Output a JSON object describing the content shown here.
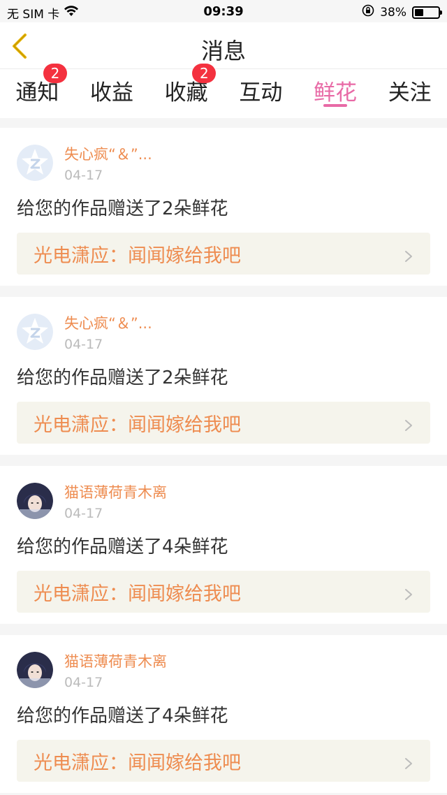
{
  "statusbar": {
    "carrier": "无 SIM 卡",
    "time": "09:39",
    "battery": "38%",
    "battery_level": 0.38
  },
  "navbar": {
    "title": "消息"
  },
  "tabs": [
    {
      "label": "通知",
      "badge": "2"
    },
    {
      "label": "收益",
      "badge": ""
    },
    {
      "label": "收藏",
      "badge": "2"
    },
    {
      "label": "互动",
      "badge": ""
    },
    {
      "label": "鲜花",
      "badge": "",
      "active": true
    },
    {
      "label": "关注",
      "badge": ""
    }
  ],
  "messages": [
    {
      "name": "失心疯“＆”...",
      "date": "04-17",
      "text": "给您的作品赠送了2朵鲜花",
      "work": "光电潇应：闻闻嫁给我吧",
      "avatar": "default-avatar"
    },
    {
      "name": "失心疯“＆”...",
      "date": "04-17",
      "text": "给您的作品赠送了2朵鲜花",
      "work": "光电潇应：闻闻嫁给我吧",
      "avatar": "default-avatar"
    },
    {
      "name": "猫语薄荷青木离",
      "date": "04-17",
      "text": "给您的作品赠送了4朵鲜花",
      "work": "光电潇应：闻闻嫁给我吧",
      "avatar": "photo-avatar"
    },
    {
      "name": "猫语薄荷青木离",
      "date": "04-17",
      "text": "给您的作品赠送了4朵鲜花",
      "work": "光电潇应：闻闻嫁给我吧",
      "avatar": "photo-avatar"
    }
  ],
  "colors": {
    "accent": "#e86aa6",
    "name": "#ee8c50",
    "badge": "#f4313f",
    "back": "#e8b400"
  }
}
